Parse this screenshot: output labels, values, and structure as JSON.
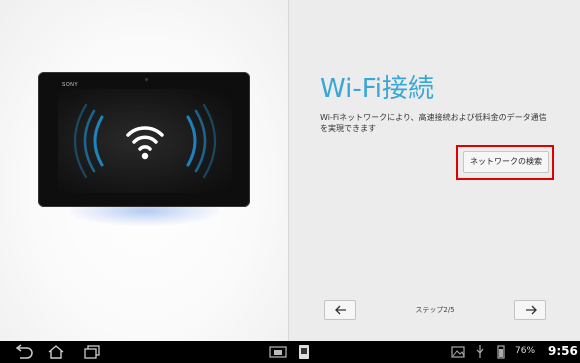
{
  "left": {
    "tablet_brand": "SONY",
    "illustration": "wifi-icon"
  },
  "main": {
    "title": "Wi-Fi接続",
    "description": "Wi-Fiネットワークにより、高速接続および低料金のデータ通信を実現できます",
    "search_button": "ネットワークの検索",
    "step_label": "ステップ2/5",
    "back_icon": "arrow-left-icon",
    "next_icon": "arrow-right-icon"
  },
  "status_bar": {
    "battery": "76%",
    "time": "9:56",
    "icons": [
      "back-icon",
      "home-icon",
      "recent-apps-icon",
      "screenshot-icon",
      "small-app-icon",
      "image-icon",
      "usb-icon",
      "battery-icon"
    ]
  },
  "colors": {
    "title": "#38a7d6",
    "highlight": "#e00000",
    "wifi_glow": "#2aa0e0"
  }
}
